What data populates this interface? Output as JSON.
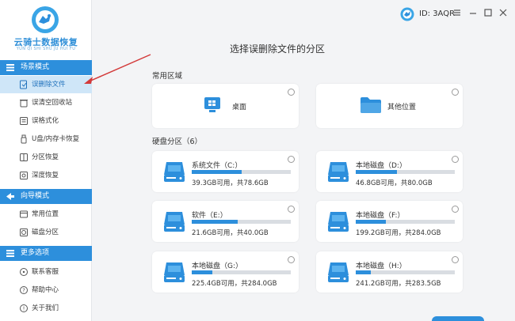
{
  "app": {
    "logo_title": "云骑士数据恢复",
    "logo_subtitle": "YUN QI SHI SHU JU HUI FU",
    "user_id": "ID: 3AQR"
  },
  "sidebar": {
    "sections": [
      {
        "label": "场景模式",
        "items": [
          "误删除文件",
          "误清空回收站",
          "误格式化",
          "U盘/内存卡恢复",
          "分区恢复",
          "深度恢复"
        ]
      },
      {
        "label": "向导模式",
        "items": [
          "常用位置",
          "磁盘分区"
        ]
      },
      {
        "label": "更多选项",
        "items": [
          "联系客服",
          "帮助中心",
          "关于我们"
        ]
      }
    ]
  },
  "main": {
    "title": "选择误删除文件的分区",
    "common_label": "常用区域",
    "common_items": [
      "桌面",
      "其他位置"
    ],
    "disk_label": "硬盘分区（6）",
    "drives": [
      {
        "name": "系统文件（C:）",
        "info": "39.3GB可用，共78.6GB",
        "used": 0.5
      },
      {
        "name": "本地磁盘（D:）",
        "info": "46.8GB可用，共80.0GB",
        "used": 0.415
      },
      {
        "name": "软件（E:）",
        "info": "21.6GB可用，共40.0GB",
        "used": 0.46
      },
      {
        "name": "本地磁盘（F:）",
        "info": "199.2GB可用，共284.0GB",
        "used": 0.3
      },
      {
        "name": "本地磁盘（G:）",
        "info": "225.4GB可用，共284.0GB",
        "used": 0.21
      },
      {
        "name": "本地磁盘（H:）",
        "info": "241.2GB可用，共283.5GB",
        "used": 0.15
      }
    ]
  },
  "colors": {
    "accent": "#2d8fdc",
    "annotation": "#d33a3a"
  }
}
